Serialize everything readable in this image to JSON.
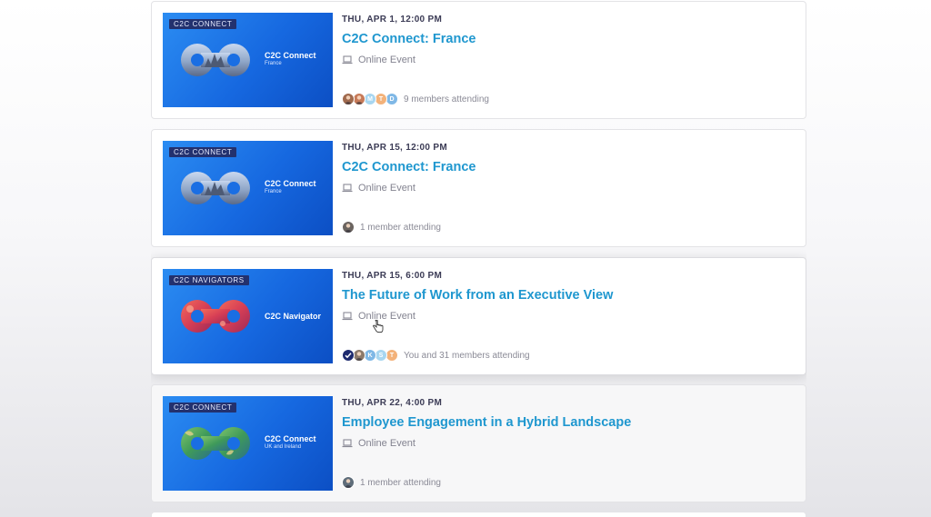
{
  "events": [
    {
      "group_tag": "C2C CONNECT",
      "thumb_brand": "C2C Connect",
      "thumb_sub": "France",
      "date": "THU, APR 1, 12:00 PM",
      "title": "C2C Connect: France",
      "venue": "Online Event",
      "attendees_label": "9 members attending",
      "avatars": [
        {
          "kind": "photo",
          "color": "#a06a4e"
        },
        {
          "kind": "photo",
          "color": "#c77a58"
        },
        {
          "kind": "letter",
          "letter": "M",
          "color": "#a8d6f0"
        },
        {
          "kind": "letter",
          "letter": "T",
          "color": "#f3b27a"
        },
        {
          "kind": "letter",
          "letter": "D",
          "color": "#7fb8e6"
        }
      ]
    },
    {
      "group_tag": "C2C CONNECT",
      "thumb_brand": "C2C Connect",
      "thumb_sub": "France",
      "date": "THU, APR 15, 12:00 PM",
      "title": "C2C Connect: France",
      "venue": "Online Event",
      "attendees_label": "1 member attending",
      "avatars": [
        {
          "kind": "photo",
          "color": "#6b6460"
        }
      ]
    },
    {
      "group_tag": "C2C NAVIGATORS",
      "thumb_brand": "C2C Navigator",
      "thumb_sub": "",
      "date": "THU, APR 15, 6:00 PM",
      "title": "The Future of Work from an Executive View",
      "venue": "Online Event",
      "attendees_label": "You and 31 members attending",
      "avatars": [
        {
          "kind": "check",
          "color": "#1e2a6e"
        },
        {
          "kind": "photo",
          "color": "#8c7a6b"
        },
        {
          "kind": "letter",
          "letter": "K",
          "color": "#7fb8e6"
        },
        {
          "kind": "letter",
          "letter": "S",
          "color": "#a8d6f0"
        },
        {
          "kind": "letter",
          "letter": "T",
          "color": "#f3b27a"
        }
      ]
    },
    {
      "group_tag": "C2C CONNECT",
      "thumb_brand": "C2C Connect",
      "thumb_sub": "UK and Ireland",
      "date": "THU, APR 22, 4:00 PM",
      "title": "Employee Engagement in a Hybrid Landscape",
      "venue": "Online Event",
      "attendees_label": "1 member attending",
      "avatars": [
        {
          "kind": "photo",
          "color": "#5f6d7a"
        }
      ]
    }
  ],
  "colors": {
    "title": "#1f97cf",
    "thumb_bg": "#1668e0",
    "tag_bg": "#23316e"
  }
}
